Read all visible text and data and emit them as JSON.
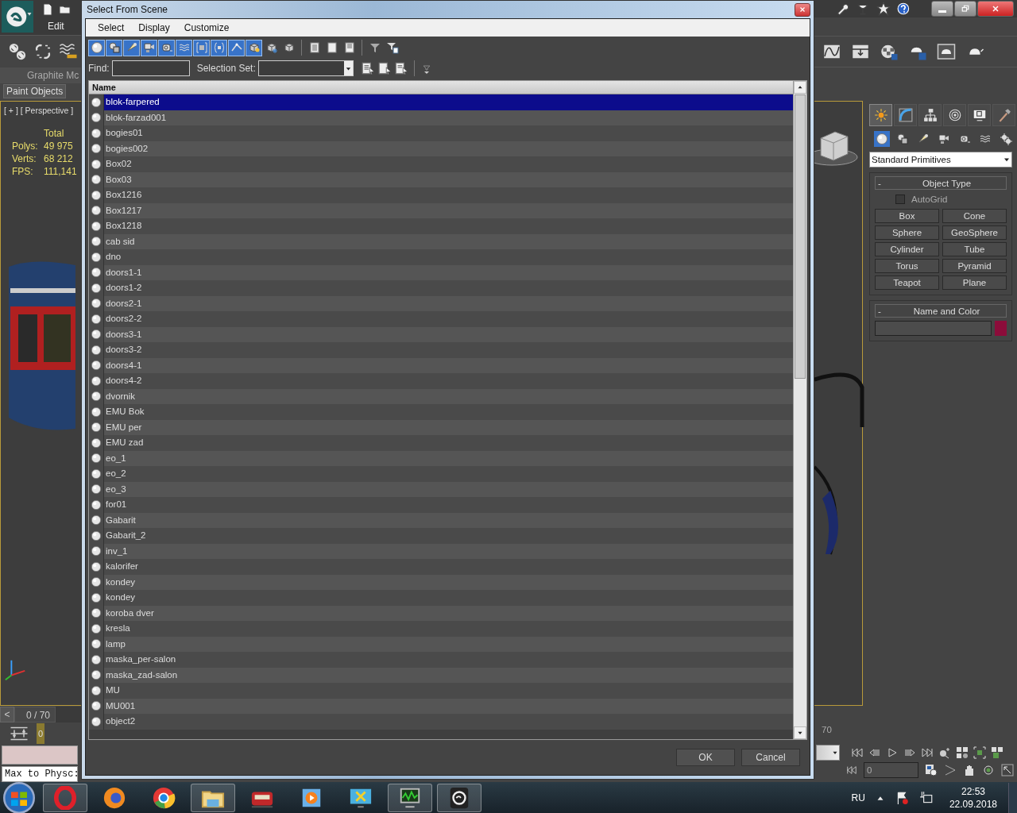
{
  "app": {
    "menu": [
      "Edit"
    ],
    "quick_access": [
      {
        "kind": "new"
      },
      {
        "kind": "open"
      }
    ],
    "main_toolbar_left": [
      {
        "kind": "link"
      },
      {
        "kind": "unlink"
      },
      {
        "kind": "bind"
      }
    ],
    "ribbon_tab": "Graphite Mc",
    "ribbon_item": "Paint Objects",
    "viewport": {
      "label": "[ + ] [ Perspective ]",
      "stats_header": "Total",
      "stats": [
        {
          "label": "Polys:",
          "value": "49 975"
        },
        {
          "label": "Verts:",
          "value": "68 212"
        },
        {
          "label": "FPS:",
          "value": "111,141"
        }
      ]
    },
    "time_slider": {
      "prev": "<",
      "reading": "0 / 70",
      "level": 0
    },
    "track_bar": {
      "start": "0",
      "end": "70"
    },
    "script_listener": "Max to Physc:",
    "title_tools": [
      {
        "kind": "wrench"
      },
      {
        "kind": "dish"
      },
      {
        "kind": "star"
      },
      {
        "kind": "help"
      }
    ],
    "main_toolbar_right": [
      {
        "kind": "curve"
      },
      {
        "kind": "schematic"
      },
      {
        "kind": "material"
      },
      {
        "kind": "render_setup"
      },
      {
        "kind": "frame_window"
      },
      {
        "kind": "render"
      }
    ],
    "command_panel": {
      "tabs": [
        {
          "kind": "create",
          "selected": true
        },
        {
          "kind": "modify",
          "selected": false
        },
        {
          "kind": "hierarchy",
          "selected": false
        },
        {
          "kind": "motion",
          "selected": false
        },
        {
          "kind": "display",
          "selected": false
        },
        {
          "kind": "utilities",
          "selected": false
        }
      ],
      "categories": [
        {
          "kind": "geometry",
          "selected": true
        },
        {
          "kind": "shapes",
          "selected": false
        },
        {
          "kind": "lights",
          "selected": false
        },
        {
          "kind": "cameras",
          "selected": false
        },
        {
          "kind": "helpers",
          "selected": false
        },
        {
          "kind": "spacewarps",
          "selected": false
        },
        {
          "kind": "systems",
          "selected": false
        }
      ],
      "dropdown": "Standard Primitives",
      "object_type": {
        "collapse": "-",
        "title": "Object Type",
        "autogrid": {
          "label": "AutoGrid",
          "checked": false
        },
        "buttons": [
          "Box",
          "Cone",
          "Sphere",
          "GeoSphere",
          "Cylinder",
          "Tube",
          "Torus",
          "Pyramid",
          "Teapot",
          "Plane"
        ]
      },
      "name_and_color": {
        "collapse": "-",
        "title": "Name and Color",
        "color": "#8c0c3a"
      }
    },
    "playback": [
      {
        "kind": "start"
      },
      {
        "kind": "prev"
      },
      {
        "kind": "play"
      },
      {
        "kind": "next"
      },
      {
        "kind": "end"
      },
      {
        "kind": "zoom"
      },
      {
        "kind": "zoom_all"
      },
      {
        "kind": "extents"
      },
      {
        "kind": "extents_all"
      }
    ],
    "frame_field": "0",
    "nav_row": [
      {
        "kind": "time_config"
      },
      {
        "kind": "fov"
      },
      {
        "kind": "pan"
      },
      {
        "kind": "orbit"
      },
      {
        "kind": "maximize"
      }
    ]
  },
  "dialog": {
    "title": "Select From Scene",
    "menu": [
      "Select",
      "Display",
      "Customize"
    ],
    "filters": [
      {
        "kind": "geometry",
        "on": true
      },
      {
        "kind": "shapes",
        "on": true
      },
      {
        "kind": "lights",
        "on": true
      },
      {
        "kind": "cameras",
        "on": true
      },
      {
        "kind": "helpers",
        "on": true
      },
      {
        "kind": "spacewarps",
        "on": true
      },
      {
        "kind": "groups",
        "on": true
      },
      {
        "kind": "xrefs",
        "on": true
      },
      {
        "kind": "bones",
        "on": true
      },
      {
        "kind": "containers",
        "on": true
      },
      {
        "kind": "frozen",
        "on": false
      },
      {
        "kind": "hidden",
        "on": false
      }
    ],
    "display_buttons": [
      {
        "kind": "all"
      },
      {
        "kind": "none"
      },
      {
        "kind": "invert"
      }
    ],
    "filter_buttons": [
      {
        "kind": "filter"
      },
      {
        "kind": "filter_options"
      }
    ],
    "find_label": "Find:",
    "selection_set_label": "Selection Set:",
    "set_buttons": [
      {
        "kind": "set_a"
      },
      {
        "kind": "set_b"
      },
      {
        "kind": "set_c"
      }
    ],
    "column": "Name",
    "rows": [
      {
        "name": "blok-farpered",
        "selected": true
      },
      {
        "name": "blok-farzad001",
        "selected": false
      },
      {
        "name": "bogies01",
        "selected": false
      },
      {
        "name": "bogies002",
        "selected": false
      },
      {
        "name": "Box02",
        "selected": false
      },
      {
        "name": "Box03",
        "selected": false
      },
      {
        "name": "Box1216",
        "selected": false
      },
      {
        "name": "Box1217",
        "selected": false
      },
      {
        "name": "Box1218",
        "selected": false
      },
      {
        "name": "cab sid",
        "selected": false
      },
      {
        "name": "dno",
        "selected": false
      },
      {
        "name": "doors1-1",
        "selected": false
      },
      {
        "name": "doors1-2",
        "selected": false
      },
      {
        "name": "doors2-1",
        "selected": false
      },
      {
        "name": "doors2-2",
        "selected": false
      },
      {
        "name": "doors3-1",
        "selected": false
      },
      {
        "name": "doors3-2",
        "selected": false
      },
      {
        "name": "doors4-1",
        "selected": false
      },
      {
        "name": "doors4-2",
        "selected": false
      },
      {
        "name": "dvornik",
        "selected": false
      },
      {
        "name": "EMU Bok",
        "selected": false
      },
      {
        "name": "EMU per",
        "selected": false
      },
      {
        "name": "EMU zad",
        "selected": false
      },
      {
        "name": "eo_1",
        "selected": false
      },
      {
        "name": "eo_2",
        "selected": false
      },
      {
        "name": "eo_3",
        "selected": false
      },
      {
        "name": "for01",
        "selected": false
      },
      {
        "name": "Gabarit",
        "selected": false
      },
      {
        "name": "Gabarit_2",
        "selected": false
      },
      {
        "name": "inv_1",
        "selected": false
      },
      {
        "name": "kalorifer",
        "selected": false
      },
      {
        "name": "kondey",
        "selected": false
      },
      {
        "name": "kondey",
        "selected": false
      },
      {
        "name": "koroba dver",
        "selected": false
      },
      {
        "name": "kresla",
        "selected": false
      },
      {
        "name": "lamp",
        "selected": false
      },
      {
        "name": "maska_per-salon",
        "selected": false
      },
      {
        "name": "maska_zad-salon",
        "selected": false
      },
      {
        "name": "MU",
        "selected": false
      },
      {
        "name": "MU001",
        "selected": false
      },
      {
        "name": "object2",
        "selected": false
      }
    ],
    "buttons": [
      "OK",
      "Cancel"
    ]
  },
  "taskbar": {
    "apps": [
      {
        "kind": "opera",
        "open": true
      },
      {
        "kind": "firefox",
        "open": false
      },
      {
        "kind": "chrome",
        "open": false
      },
      {
        "kind": "explorer",
        "open": true
      },
      {
        "kind": "train",
        "open": false
      },
      {
        "kind": "media",
        "open": false
      },
      {
        "kind": "snip",
        "open": false
      },
      {
        "kind": "monitor",
        "open": true
      },
      {
        "kind": "max",
        "open": true
      }
    ],
    "language": "RU",
    "time": "22:53",
    "date": "22.09.2018"
  }
}
